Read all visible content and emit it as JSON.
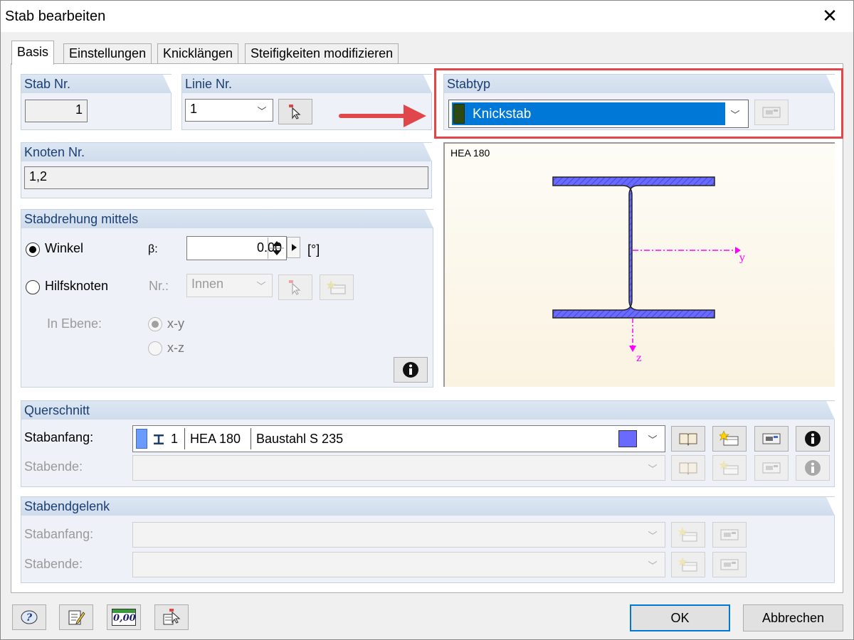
{
  "window": {
    "title": "Stab bearbeiten",
    "close_glyph": "✕"
  },
  "tabs": [
    {
      "label": "Basis",
      "active": true
    },
    {
      "label": "Einstellungen",
      "active": false
    },
    {
      "label": "Knicklängen",
      "active": false
    },
    {
      "label": "Steifigkeiten modifizieren",
      "active": false
    }
  ],
  "stab_nr": {
    "title": "Stab Nr.",
    "value": "1"
  },
  "linie_nr": {
    "title": "Linie Nr.",
    "value": "1"
  },
  "stabtyp": {
    "title": "Stabtyp",
    "value": "Knickstab",
    "swatch_color": "#2d4a12",
    "select_color": "#0078d7"
  },
  "knoten_nr": {
    "title": "Knoten Nr.",
    "value": "1,2"
  },
  "stabdrehung": {
    "title": "Stabdrehung mittels",
    "winkel_label": "Winkel",
    "beta_label": "β:",
    "beta_value": "0.00",
    "unit": "[°]",
    "hilfsknoten_label": "Hilfsknoten",
    "nr_label": "Nr.:",
    "nr_value": "Innen",
    "in_ebene_label": "In Ebene:",
    "xy_label": "x-y",
    "xz_label": "x-z"
  },
  "preview": {
    "profile_label": "HEA 180",
    "y_axis": "y",
    "z_axis": "z",
    "axis_color": "#ff00ff",
    "fill_color": "#6a6aff"
  },
  "querschnitt": {
    "title": "Querschnitt",
    "stabanfang_label": "Stabanfang:",
    "stabende_label": "Stabende:",
    "number": "1",
    "profile": "HEA 180",
    "material": "Baustahl S 235",
    "color": "#6a6aff"
  },
  "stabendgelenk": {
    "title": "Stabendgelenk",
    "stabanfang_label": "Stabanfang:",
    "stabende_label": "Stabende:"
  },
  "footer": {
    "ok_label": "OK",
    "cancel_label": "Abbrechen",
    "counter_glyph": "0,00"
  },
  "colors": {
    "annotation_red": "#e0464a",
    "group_title": "#1c3f72"
  }
}
